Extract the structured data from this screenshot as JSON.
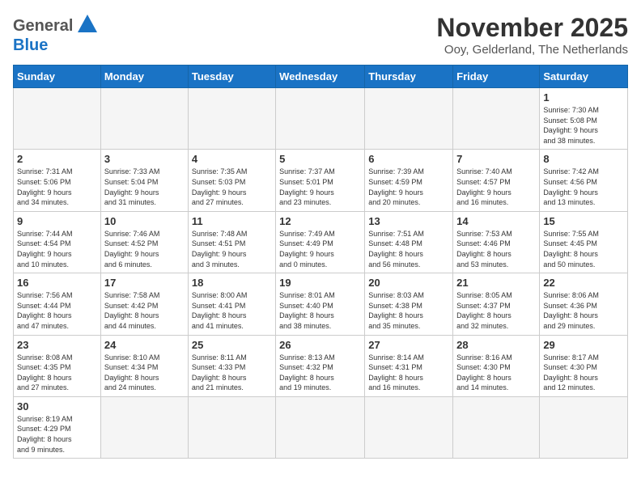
{
  "header": {
    "logo_general": "General",
    "logo_blue": "Blue",
    "month_title": "November 2025",
    "location": "Ooy, Gelderland, The Netherlands"
  },
  "weekdays": [
    "Sunday",
    "Monday",
    "Tuesday",
    "Wednesday",
    "Thursday",
    "Friday",
    "Saturday"
  ],
  "weeks": [
    {
      "days": [
        {
          "number": "",
          "info": "",
          "empty": true
        },
        {
          "number": "",
          "info": "",
          "empty": true
        },
        {
          "number": "",
          "info": "",
          "empty": true
        },
        {
          "number": "",
          "info": "",
          "empty": true
        },
        {
          "number": "",
          "info": "",
          "empty": true
        },
        {
          "number": "",
          "info": "",
          "empty": true
        },
        {
          "number": "1",
          "info": "Sunrise: 7:30 AM\nSunset: 5:08 PM\nDaylight: 9 hours\nand 38 minutes."
        }
      ]
    },
    {
      "days": [
        {
          "number": "2",
          "info": "Sunrise: 7:31 AM\nSunset: 5:06 PM\nDaylight: 9 hours\nand 34 minutes."
        },
        {
          "number": "3",
          "info": "Sunrise: 7:33 AM\nSunset: 5:04 PM\nDaylight: 9 hours\nand 31 minutes."
        },
        {
          "number": "4",
          "info": "Sunrise: 7:35 AM\nSunset: 5:03 PM\nDaylight: 9 hours\nand 27 minutes."
        },
        {
          "number": "5",
          "info": "Sunrise: 7:37 AM\nSunset: 5:01 PM\nDaylight: 9 hours\nand 23 minutes."
        },
        {
          "number": "6",
          "info": "Sunrise: 7:39 AM\nSunset: 4:59 PM\nDaylight: 9 hours\nand 20 minutes."
        },
        {
          "number": "7",
          "info": "Sunrise: 7:40 AM\nSunset: 4:57 PM\nDaylight: 9 hours\nand 16 minutes."
        },
        {
          "number": "8",
          "info": "Sunrise: 7:42 AM\nSunset: 4:56 PM\nDaylight: 9 hours\nand 13 minutes."
        }
      ]
    },
    {
      "days": [
        {
          "number": "9",
          "info": "Sunrise: 7:44 AM\nSunset: 4:54 PM\nDaylight: 9 hours\nand 10 minutes."
        },
        {
          "number": "10",
          "info": "Sunrise: 7:46 AM\nSunset: 4:52 PM\nDaylight: 9 hours\nand 6 minutes."
        },
        {
          "number": "11",
          "info": "Sunrise: 7:48 AM\nSunset: 4:51 PM\nDaylight: 9 hours\nand 3 minutes."
        },
        {
          "number": "12",
          "info": "Sunrise: 7:49 AM\nSunset: 4:49 PM\nDaylight: 9 hours\nand 0 minutes."
        },
        {
          "number": "13",
          "info": "Sunrise: 7:51 AM\nSunset: 4:48 PM\nDaylight: 8 hours\nand 56 minutes."
        },
        {
          "number": "14",
          "info": "Sunrise: 7:53 AM\nSunset: 4:46 PM\nDaylight: 8 hours\nand 53 minutes."
        },
        {
          "number": "15",
          "info": "Sunrise: 7:55 AM\nSunset: 4:45 PM\nDaylight: 8 hours\nand 50 minutes."
        }
      ]
    },
    {
      "days": [
        {
          "number": "16",
          "info": "Sunrise: 7:56 AM\nSunset: 4:44 PM\nDaylight: 8 hours\nand 47 minutes."
        },
        {
          "number": "17",
          "info": "Sunrise: 7:58 AM\nSunset: 4:42 PM\nDaylight: 8 hours\nand 44 minutes."
        },
        {
          "number": "18",
          "info": "Sunrise: 8:00 AM\nSunset: 4:41 PM\nDaylight: 8 hours\nand 41 minutes."
        },
        {
          "number": "19",
          "info": "Sunrise: 8:01 AM\nSunset: 4:40 PM\nDaylight: 8 hours\nand 38 minutes."
        },
        {
          "number": "20",
          "info": "Sunrise: 8:03 AM\nSunset: 4:38 PM\nDaylight: 8 hours\nand 35 minutes."
        },
        {
          "number": "21",
          "info": "Sunrise: 8:05 AM\nSunset: 4:37 PM\nDaylight: 8 hours\nand 32 minutes."
        },
        {
          "number": "22",
          "info": "Sunrise: 8:06 AM\nSunset: 4:36 PM\nDaylight: 8 hours\nand 29 minutes."
        }
      ]
    },
    {
      "days": [
        {
          "number": "23",
          "info": "Sunrise: 8:08 AM\nSunset: 4:35 PM\nDaylight: 8 hours\nand 27 minutes."
        },
        {
          "number": "24",
          "info": "Sunrise: 8:10 AM\nSunset: 4:34 PM\nDaylight: 8 hours\nand 24 minutes."
        },
        {
          "number": "25",
          "info": "Sunrise: 8:11 AM\nSunset: 4:33 PM\nDaylight: 8 hours\nand 21 minutes."
        },
        {
          "number": "26",
          "info": "Sunrise: 8:13 AM\nSunset: 4:32 PM\nDaylight: 8 hours\nand 19 minutes."
        },
        {
          "number": "27",
          "info": "Sunrise: 8:14 AM\nSunset: 4:31 PM\nDaylight: 8 hours\nand 16 minutes."
        },
        {
          "number": "28",
          "info": "Sunrise: 8:16 AM\nSunset: 4:30 PM\nDaylight: 8 hours\nand 14 minutes."
        },
        {
          "number": "29",
          "info": "Sunrise: 8:17 AM\nSunset: 4:30 PM\nDaylight: 8 hours\nand 12 minutes."
        }
      ]
    },
    {
      "days": [
        {
          "number": "30",
          "info": "Sunrise: 8:19 AM\nSunset: 4:29 PM\nDaylight: 8 hours\nand 9 minutes."
        },
        {
          "number": "",
          "info": "",
          "empty": true
        },
        {
          "number": "",
          "info": "",
          "empty": true
        },
        {
          "number": "",
          "info": "",
          "empty": true
        },
        {
          "number": "",
          "info": "",
          "empty": true
        },
        {
          "number": "",
          "info": "",
          "empty": true
        },
        {
          "number": "",
          "info": "",
          "empty": true
        }
      ]
    }
  ]
}
